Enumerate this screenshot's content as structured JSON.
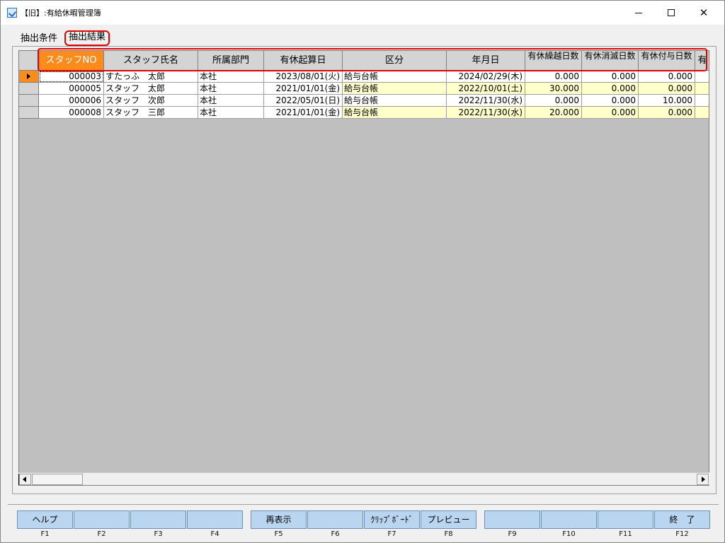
{
  "window": {
    "title": "【旧】:有給休暇管理簿",
    "minimize_label": "",
    "maximize_label": "",
    "close_label": "✕"
  },
  "tabs": [
    {
      "label": "抽出条件",
      "active": false
    },
    {
      "label": "抽出結果",
      "active": true
    }
  ],
  "grid": {
    "columns": [
      {
        "key": "staff_no",
        "label": "スタッフNO"
      },
      {
        "key": "staff_name",
        "label": "スタッフ氏名"
      },
      {
        "key": "department",
        "label": "所属部門"
      },
      {
        "key": "start_date",
        "label": "有休起算日"
      },
      {
        "key": "category",
        "label": "区分"
      },
      {
        "key": "year_month_day",
        "label": "年月日"
      },
      {
        "key": "carryover_days",
        "label": "有休繰越日数"
      },
      {
        "key": "expired_days",
        "label": "有休消滅日数"
      },
      {
        "key": "granted_days",
        "label": "有休付与日数"
      },
      {
        "key": "more",
        "label": "有"
      }
    ],
    "rows": [
      {
        "staff_no": "000003",
        "staff_name": "すたっふ　太郎",
        "department": "本社",
        "start_date": "2023/08/01(火)",
        "category": "給与台帳",
        "year_month_day": "2024/02/29(木)",
        "carryover_days": "0.000",
        "expired_days": "0.000",
        "granted_days": "0.000",
        "current": true,
        "highlight": false
      },
      {
        "staff_no": "000005",
        "staff_name": "スタッフ　太郎",
        "department": "本社",
        "start_date": "2021/01/01(金)",
        "category": "給与台帳",
        "year_month_day": "2022/10/01(土)",
        "carryover_days": "30.000",
        "expired_days": "0.000",
        "granted_days": "0.000",
        "current": false,
        "highlight": true
      },
      {
        "staff_no": "000006",
        "staff_name": "スタッフ　次郎",
        "department": "本社",
        "start_date": "2022/05/01(日)",
        "category": "給与台帳",
        "year_month_day": "2022/11/30(水)",
        "carryover_days": "0.000",
        "expired_days": "0.000",
        "granted_days": "10.000",
        "current": false,
        "highlight": false
      },
      {
        "staff_no": "000008",
        "staff_name": "スタッフ　三郎",
        "department": "本社",
        "start_date": "2021/01/01(金)",
        "category": "給与台帳",
        "year_month_day": "2022/11/30(水)",
        "carryover_days": "20.000",
        "expired_days": "0.000",
        "granted_days": "0.000",
        "current": false,
        "highlight": true
      }
    ]
  },
  "function_keys": [
    {
      "key": "F1",
      "label": "ヘルプ"
    },
    {
      "key": "F2",
      "label": ""
    },
    {
      "key": "F3",
      "label": ""
    },
    {
      "key": "F4",
      "label": ""
    },
    {
      "key": "F5",
      "label": "再表示"
    },
    {
      "key": "F6",
      "label": ""
    },
    {
      "key": "F7",
      "label": "ｸﾘｯﾌﾟﾎﾞｰﾄﾞ"
    },
    {
      "key": "F8",
      "label": "プレビュー"
    },
    {
      "key": "F9",
      "label": ""
    },
    {
      "key": "F10",
      "label": ""
    },
    {
      "key": "F11",
      "label": ""
    },
    {
      "key": "F12",
      "label": "終　了"
    }
  ],
  "colors": {
    "active_header": "#ff8c1a",
    "highlight_row": "#ffffcc",
    "annotation_red": "#e00000",
    "fkey_bg": "#b9d5f0",
    "grid_bg": "#bfbfbf"
  }
}
